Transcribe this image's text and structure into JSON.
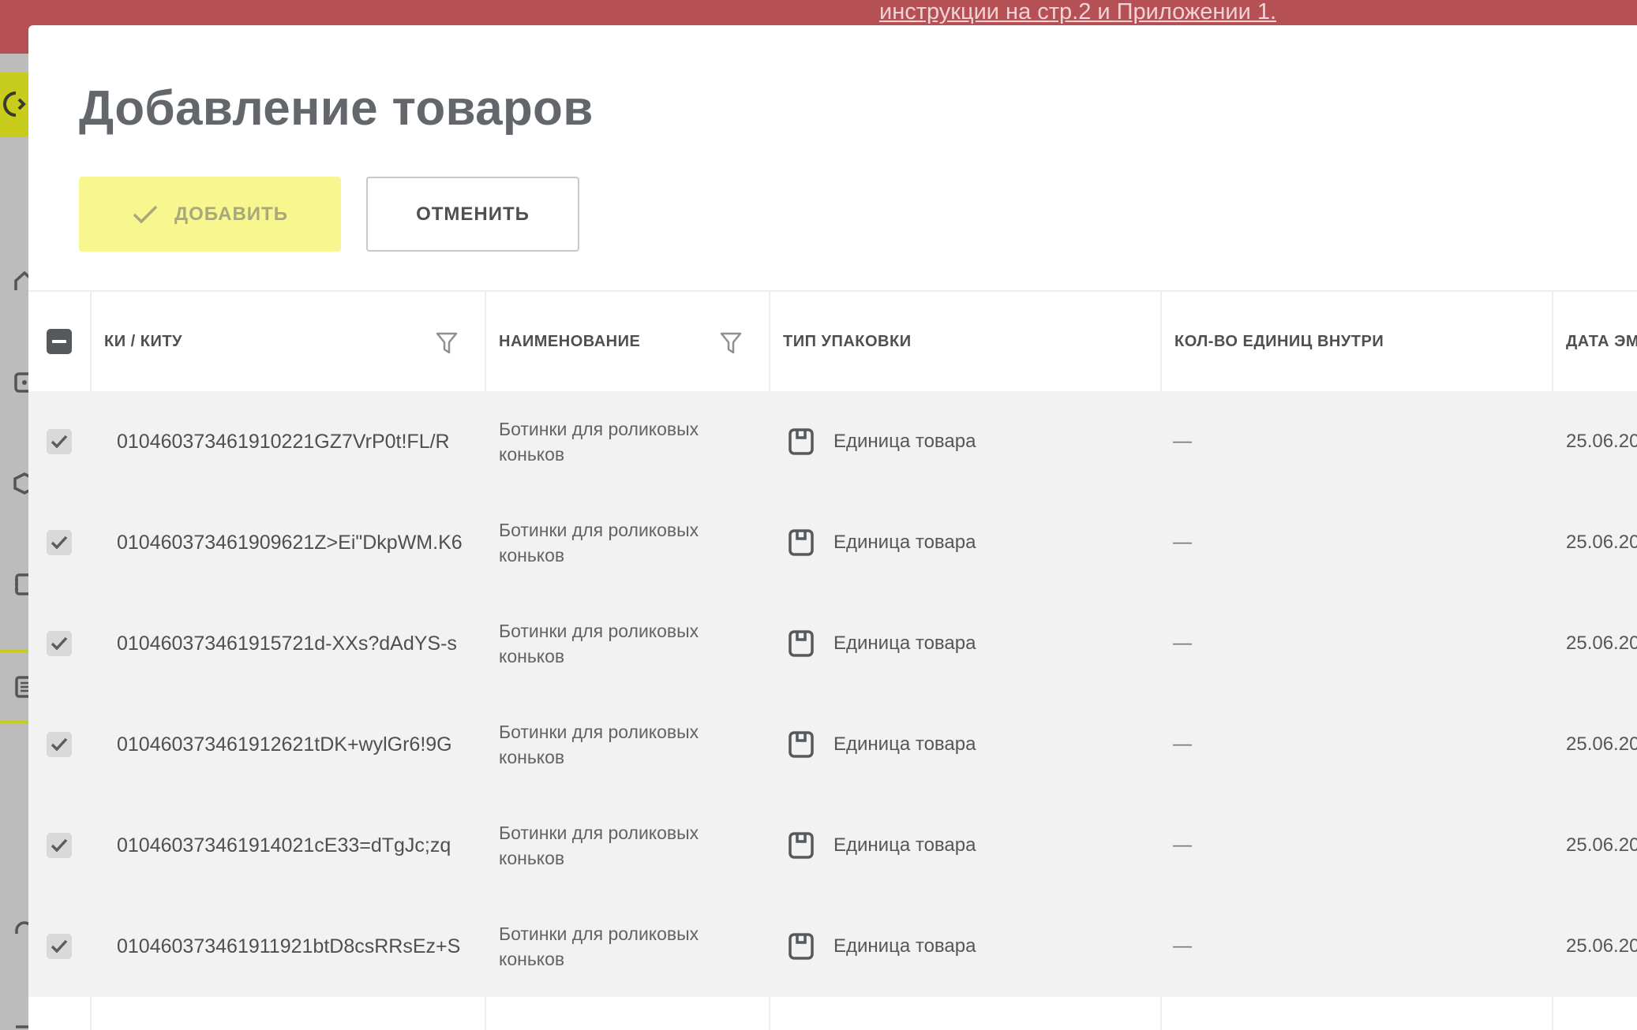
{
  "banner": {
    "link_text": "инструкции на стр.2 и Приложении 1."
  },
  "modal": {
    "title": "Добавление товаров",
    "add_button": "ДОБАВИТЬ",
    "cancel_button": "ОТМЕНИТЬ"
  },
  "table": {
    "columns": [
      {
        "label": "КИ / КИТУ",
        "filterable": true
      },
      {
        "label": "НАИМЕНОВАНИЕ",
        "filterable": true
      },
      {
        "label": "ТИП УПАКОВКИ",
        "filterable": false
      },
      {
        "label": "КОЛ-ВО ЕДИНИЦ ВНУТРИ",
        "filterable": false
      },
      {
        "label": "ДАТА ЭМ",
        "filterable": false
      }
    ],
    "rows": [
      {
        "code": "010460373461910221GZ7VrP0t!FL/R",
        "name": "Ботинки для роликовых коньков",
        "pack": "Единица товара",
        "qty": "—",
        "date": "25.06.20",
        "checked": true
      },
      {
        "code": "010460373461909621Z>Ei\"DkpWM.K6",
        "name": "Ботинки для роликовых коньков",
        "pack": "Единица товара",
        "qty": "—",
        "date": "25.06.20",
        "checked": true
      },
      {
        "code": "010460373461915721d-XXs?dAdYS-s",
        "name": "Ботинки для роликовых коньков",
        "pack": "Единица товара",
        "qty": "—",
        "date": "25.06.20",
        "checked": true
      },
      {
        "code": "010460373461912621tDK+wylGr6!9G",
        "name": "Ботинки для роликовых коньков",
        "pack": "Единица товара",
        "qty": "—",
        "date": "25.06.20",
        "checked": true
      },
      {
        "code": "010460373461914021cE33=dTgJc;zq",
        "name": "Ботинки для роликовых коньков",
        "pack": "Единица товара",
        "qty": "—",
        "date": "25.06.20",
        "checked": true
      },
      {
        "code": "010460373461911921btD8csRRsEz+S",
        "name": "Ботинки для роликовых коньков",
        "pack": "Единица товара",
        "qty": "—",
        "date": "25.06.20",
        "checked": true
      }
    ]
  },
  "colors": {
    "banner": "#b55055",
    "accent": "#c7cc1d",
    "add_button_bg": "#f7f68f",
    "header_checkbox": "#55585c"
  }
}
